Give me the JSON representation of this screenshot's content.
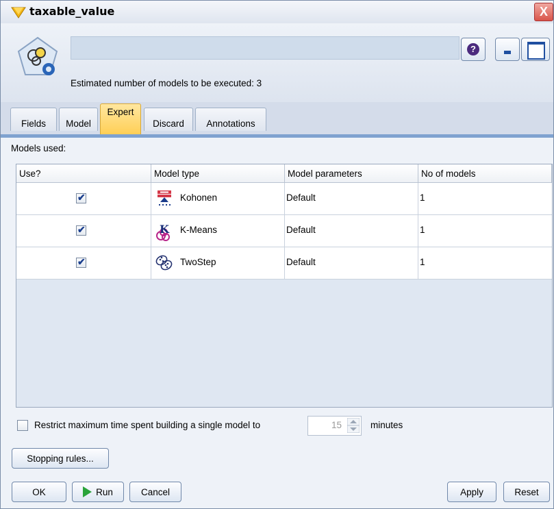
{
  "window": {
    "title": "taxable_value",
    "close_label": "X"
  },
  "header": {
    "name_value": "",
    "estimate_text": "Estimated number of models to be executed: 3",
    "help_label": "?"
  },
  "tabs": [
    {
      "label": "Fields",
      "active": false
    },
    {
      "label": "Model",
      "active": false
    },
    {
      "label": "Expert",
      "active": true
    },
    {
      "label": "Discard",
      "active": false
    },
    {
      "label": "Annotations",
      "active": false
    }
  ],
  "models": {
    "label": "Models used:",
    "columns": [
      "Use?",
      "Model type",
      "Model parameters",
      "No of models"
    ],
    "rows": [
      {
        "use": true,
        "icon": "kohonen-icon",
        "type": "Kohonen",
        "params": "Default",
        "count": "1"
      },
      {
        "use": true,
        "icon": "kmeans-icon",
        "type": "K-Means",
        "params": "Default",
        "count": "1"
      },
      {
        "use": true,
        "icon": "twostep-icon",
        "type": "TwoStep",
        "params": "Default",
        "count": "1"
      }
    ]
  },
  "restrict": {
    "checked": false,
    "label": "Restrict maximum time spent building a single model to",
    "value": "15",
    "unit": "minutes"
  },
  "buttons": {
    "stopping_rules": "Stopping rules...",
    "ok": "OK",
    "run": "Run",
    "cancel": "Cancel",
    "apply": "Apply",
    "reset": "Reset"
  },
  "colors": {
    "accent_tab": "#ffcf56",
    "tab_line": "#7fa2d0",
    "check": "#1b3f8e",
    "run": "#2aa33a"
  }
}
